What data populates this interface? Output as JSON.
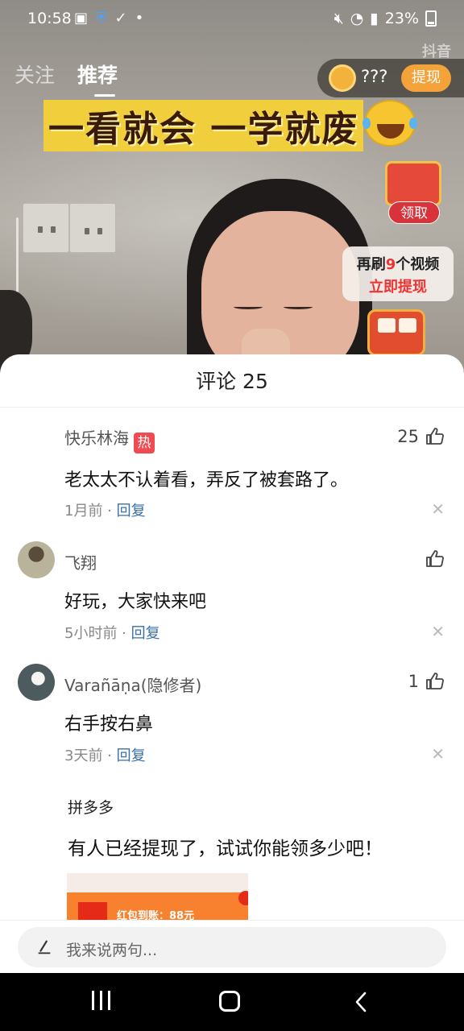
{
  "status_bar": {
    "time": "10:58",
    "battery": "23%"
  },
  "video": {
    "tabs": [
      "关注",
      "推荐"
    ],
    "active_tab": "推荐",
    "watermark": "抖音",
    "coin_amount": "???",
    "withdraw_label": "提现",
    "caption": "一看就会 一学就废",
    "claim_label": "领取",
    "promo": {
      "prefix": "再刷",
      "count": "9",
      "suffix": "个视频",
      "cta": "立即提现"
    }
  },
  "comments_sheet": {
    "title": "评论 25",
    "comments": [
      {
        "name": "快乐林海",
        "badge": "热",
        "text": "老太太不认着看，弄反了被套路了。",
        "time": "1月前",
        "reply_label": "回复",
        "likes": "25"
      },
      {
        "name": "飞翔",
        "text": "好玩，大家快来吧",
        "time": "5小时前",
        "reply_label": "回复",
        "likes": ""
      },
      {
        "name": "Varañāṇa(隐修者)",
        "text": "右手按右鼻",
        "time": "3天前",
        "reply_label": "回复",
        "likes": "1"
      }
    ],
    "ad": {
      "brand": "拼多多",
      "text": "有人已经提现了，试试你能领多少吧！",
      "image_text": "红包到账：88元"
    },
    "input_placeholder": "我来说两句..."
  },
  "colors": {
    "reply_link": "#3a6fa8",
    "hot_badge": "#f04a52",
    "withdraw_button": "#f4a23a"
  }
}
